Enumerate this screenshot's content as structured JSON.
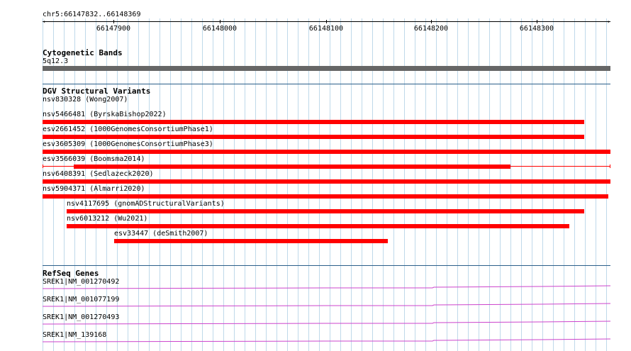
{
  "ruler": {
    "location": "chr5:66147832..66148369",
    "ticks": [
      "66147900",
      "66148000",
      "66148100",
      "66148200",
      "66148300"
    ]
  },
  "cytoband": {
    "title": "Cytogenetic Bands",
    "band": "5q12.3",
    "color": "#666666"
  },
  "dgv": {
    "title": "DGV Structural Variants",
    "variants": [
      {
        "label": "nsv830328 (Wong2007)"
      },
      {
        "label": "nsv5466481 (ByrskaBishop2022)"
      },
      {
        "label": "esv2661452 (1000GenomesConsortiumPhase1)"
      },
      {
        "label": "esv3605309 (1000GenomesConsortiumPhase3)"
      },
      {
        "label": "esv3566039 (Boomsma2014)"
      },
      {
        "label": "nsv6408391 (Sedlazeck2020)"
      },
      {
        "label": "nsv5904371 (Almarri2020)"
      },
      {
        "label": "nsv4117695 (gnomADStructuralVariants)"
      },
      {
        "label": "nsv6013212 (Wu2021)"
      },
      {
        "label": "esv33447 (deSmith2007)"
      }
    ],
    "color": "#ff0000"
  },
  "refseq": {
    "title": "RefSeq Genes",
    "genes": [
      {
        "label": "SREK1|NM_001270492"
      },
      {
        "label": "SREK1|NM_001077199"
      },
      {
        "label": "SREK1|NM_001270493"
      },
      {
        "label": "SREK1|NM_139168"
      }
    ],
    "color": "#cc44cc"
  }
}
